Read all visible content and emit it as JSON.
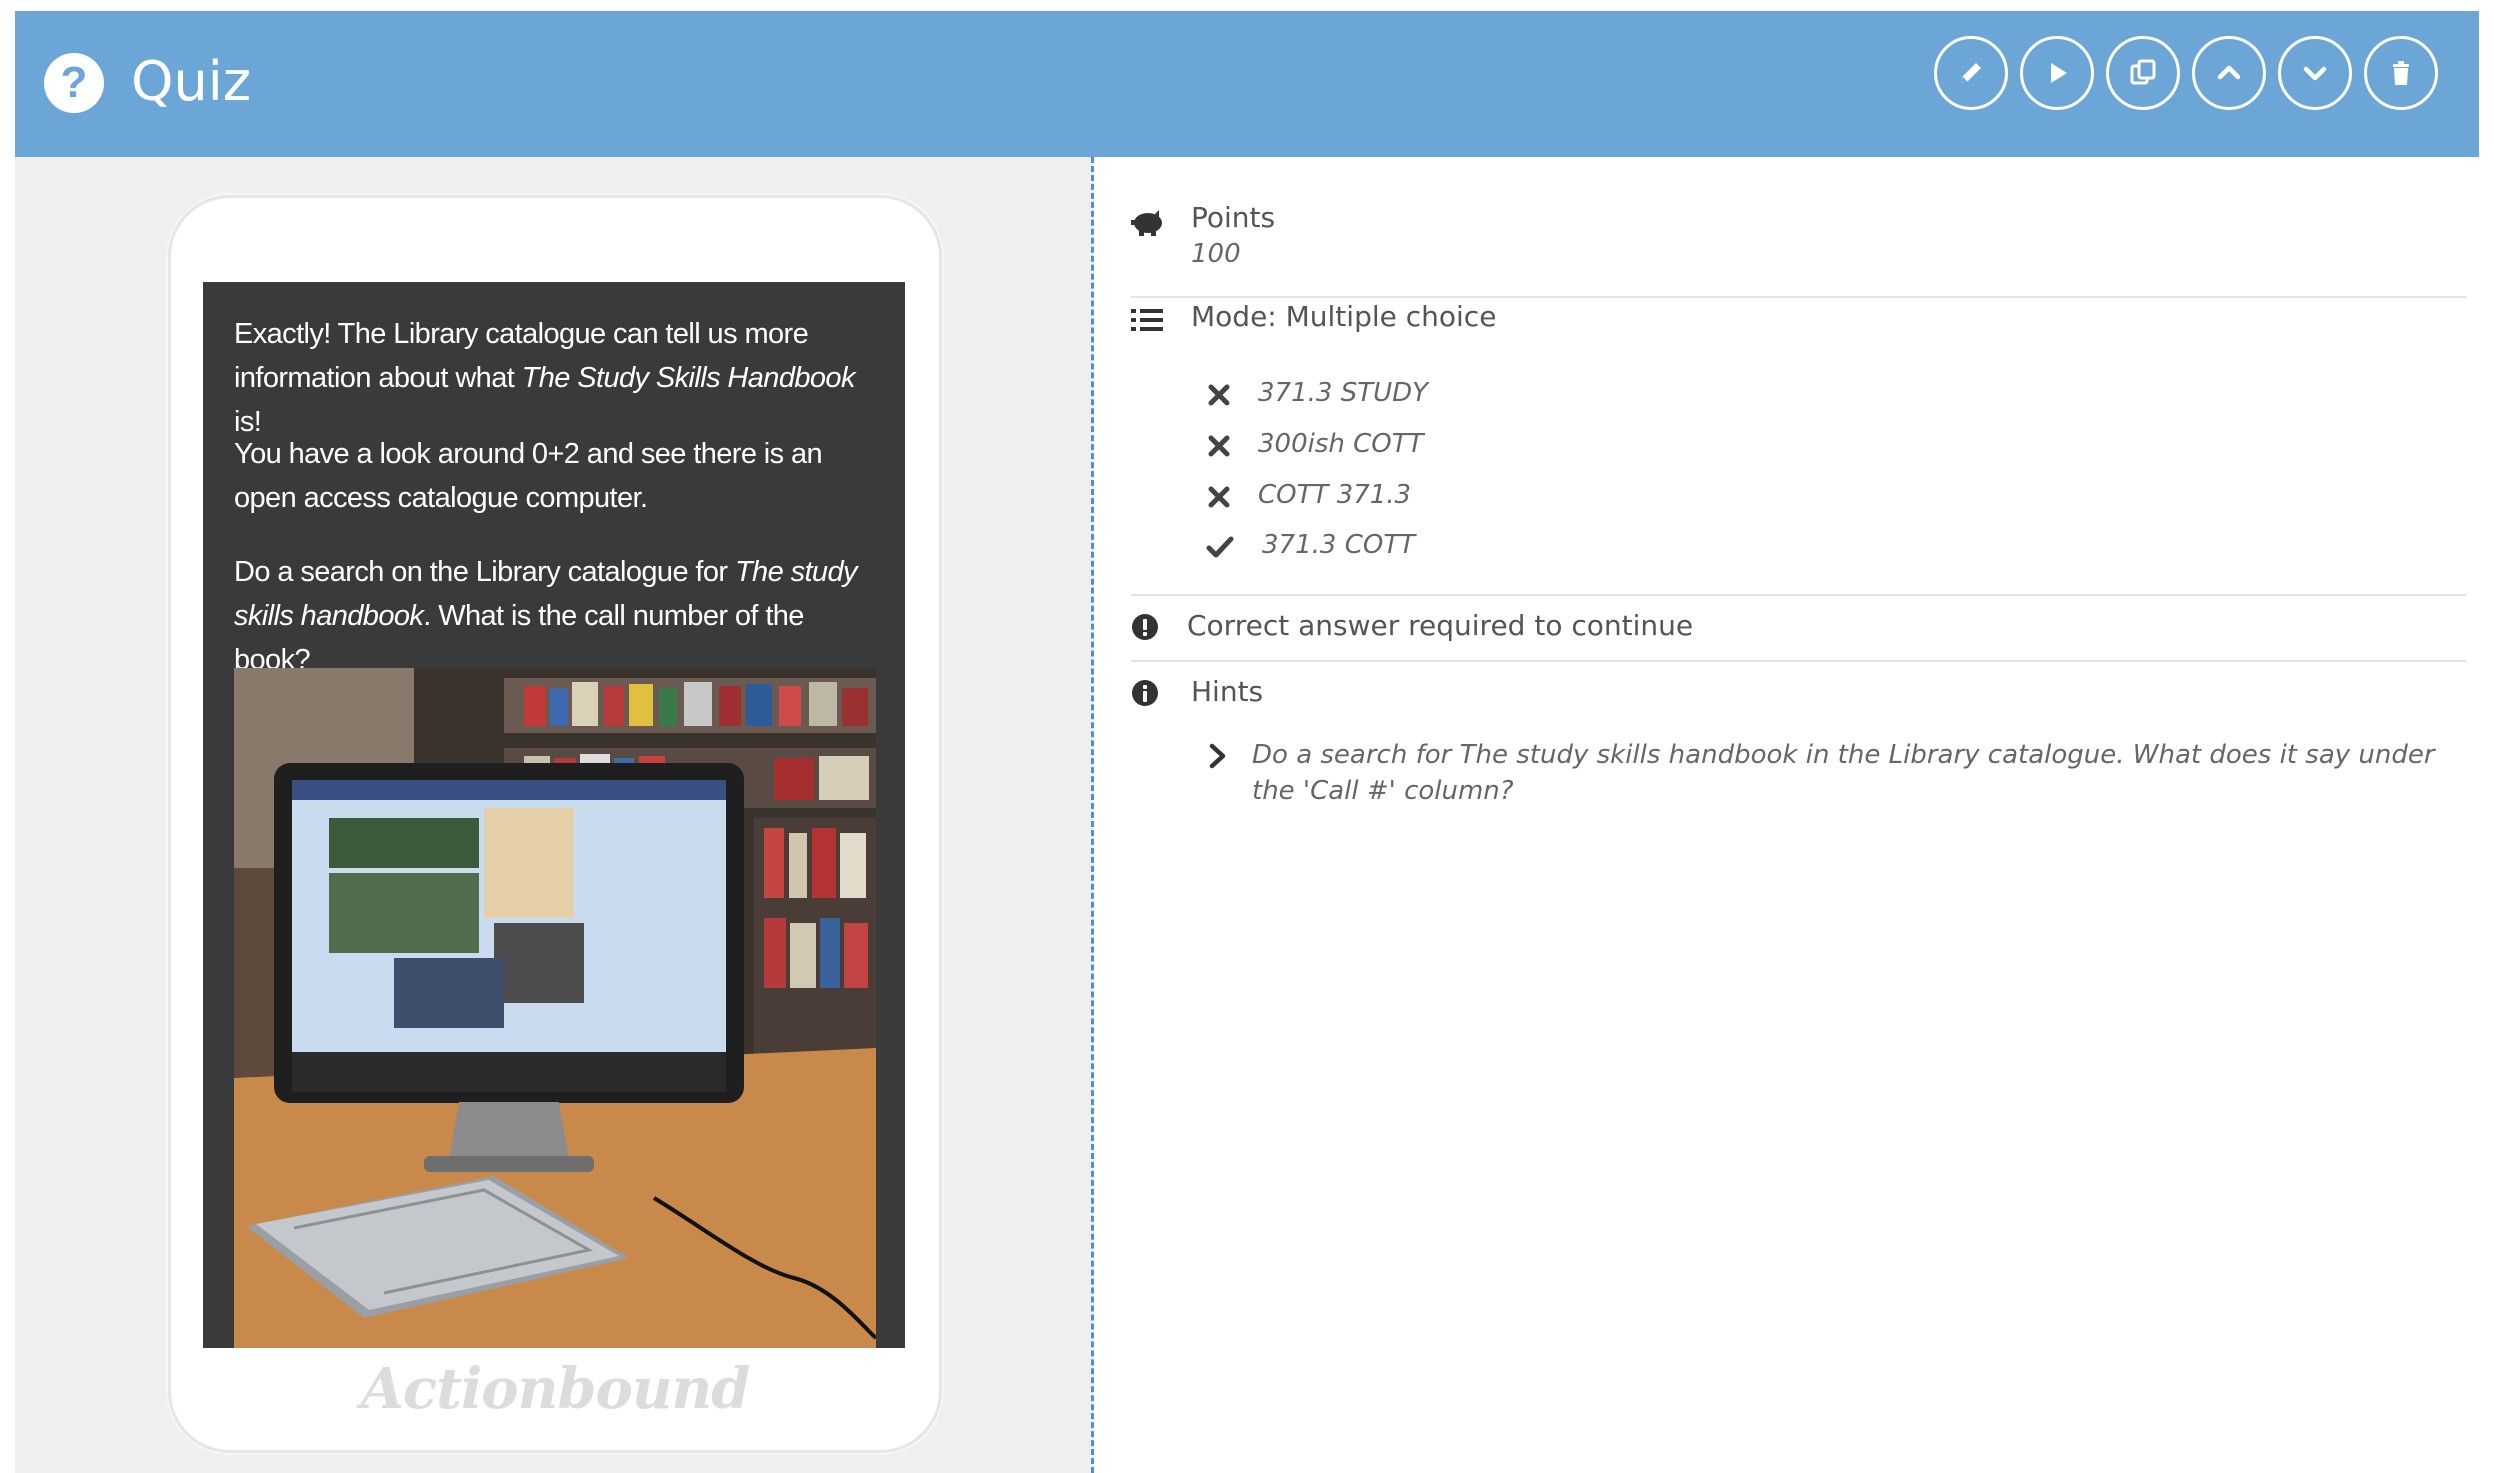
{
  "header": {
    "title": "Quiz",
    "help_icon": "question-circle-icon",
    "toolbar": [
      "pencil-icon",
      "play-icon",
      "copy-icon",
      "chevron-up-icon",
      "chevron-down-icon",
      "trash-icon"
    ]
  },
  "preview": {
    "paragraphs": [
      {
        "pre": "Exactly! The Library catalogue can tell us more information about what ",
        "em": "The Study Skills Handbook",
        "post": " is!"
      },
      {
        "pre": "You have a look around 0+2 and see there is an open access catalogue computer.",
        "em": "",
        "post": ""
      },
      {
        "pre": "Do a search on the Library catalogue for ",
        "em": "The study skills handbook",
        "post": ". What is the call number of the book?"
      }
    ],
    "brand": "Actionbound"
  },
  "details": {
    "points_label": "Points",
    "points_value": "100",
    "mode_label": "Mode: Multiple choice",
    "options": [
      {
        "text": "371.3 STUDY",
        "correct": false
      },
      {
        "text": "300ish COTT",
        "correct": false
      },
      {
        "text": "COTT 371.3",
        "correct": false
      },
      {
        "text": "371.3 COTT",
        "correct": true
      }
    ],
    "required_label": "Correct answer required to continue",
    "hints_label": "Hints",
    "hint_text": "Do a search for The study skills handbook in the Library catalogue. What does it say under the 'Call #' column?"
  },
  "colors": {
    "header_bg": "#6ba6d6",
    "divider": "#4a90d9",
    "screen_bg": "#3a3a3a"
  }
}
